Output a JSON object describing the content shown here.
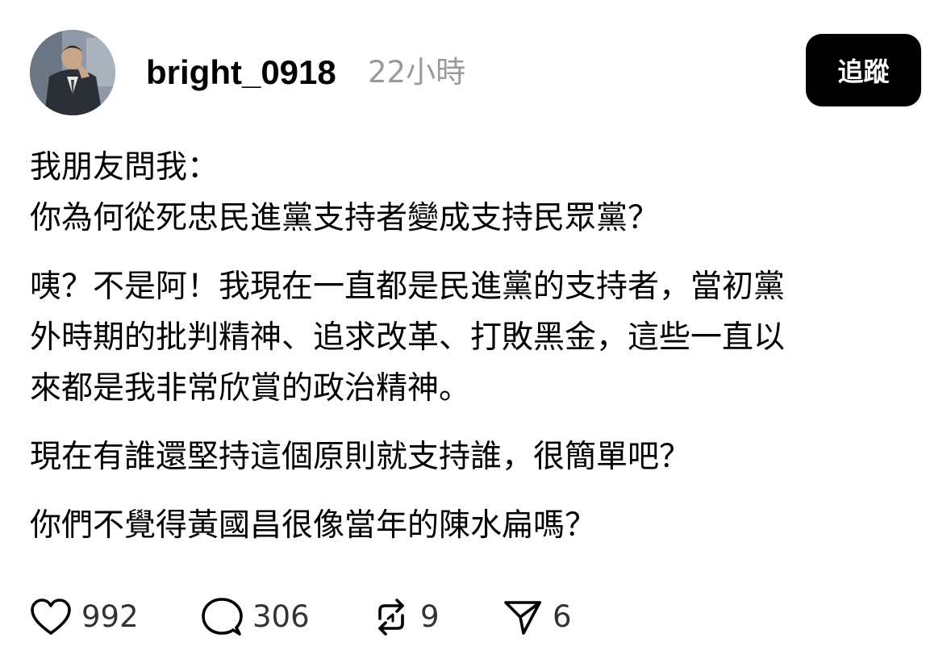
{
  "header": {
    "username": "bright_0918",
    "timestamp": "22小時",
    "follow_label": "追蹤"
  },
  "post": {
    "paragraphs": [
      "我朋友問我：\n你為何從死忠民進黨支持者變成支持民眾黨？",
      "咦？不是阿！我現在一直都是民進黨的支持者，當初黨\n外時期的批判精神、追求改革、打敗黑金，這些一直以\n來都是我非常欣賞的政治精神。",
      "現在有誰還堅持這個原則就支持誰，很簡單吧？",
      "你們不覺得黃國昌很像當年的陳水扁嗎？"
    ]
  },
  "actions": {
    "like": {
      "icon": "heart-icon",
      "count": "992"
    },
    "comment": {
      "icon": "comment-icon",
      "count": "306"
    },
    "repost": {
      "icon": "repost-icon",
      "count": "9"
    },
    "share": {
      "icon": "send-icon",
      "count": "6"
    }
  }
}
